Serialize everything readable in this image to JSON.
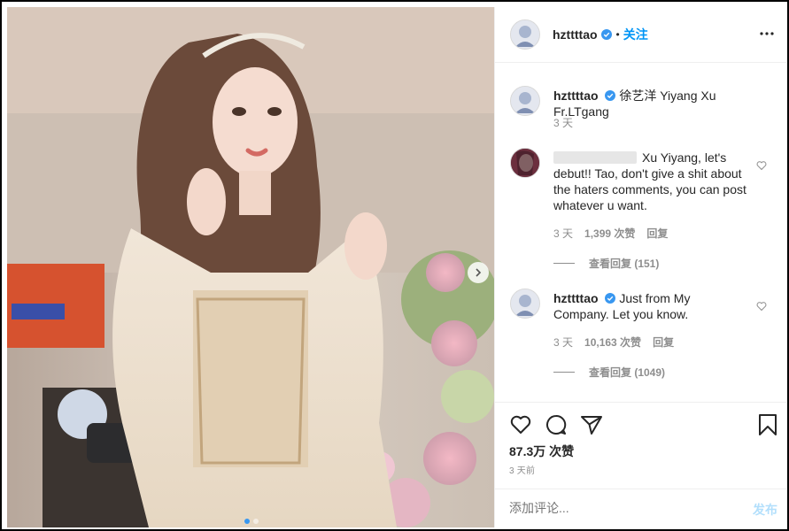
{
  "post": {
    "username": "hzttttao",
    "follow_label": "关注",
    "separator": "•"
  },
  "caption": {
    "username": "hzttttao",
    "text": "徐艺洋 Yiyang Xu Fr.LTgang",
    "time": "3 天"
  },
  "comments": [
    {
      "text": "Xu Yiyang, let's debut!! Tao, don't give a shit about the haters comments, you can post whatever u want.",
      "time": "3 天",
      "likes": "1,399 次赞",
      "reply_label": "回复",
      "view_replies": "查看回复 (151)"
    },
    {
      "username": "hzttttao",
      "text": "Just from My Company. Let you know.",
      "time": "3 天",
      "likes": "10,163 次赞",
      "reply_label": "回复",
      "view_replies": "查看回复 (1049)"
    }
  ],
  "stats": {
    "likes": "87.3万 次赞",
    "posted": "3 天前"
  },
  "composer": {
    "placeholder": "添加评论...",
    "post_label": "发布"
  },
  "colors": {
    "accent": "#0095f6",
    "verified": "#3897f0",
    "muted": "#8e8e8e"
  },
  "icons": [
    "verified-icon",
    "more-icon",
    "heart-icon",
    "comment-icon",
    "share-icon",
    "bookmark-icon",
    "chevron-right-icon"
  ]
}
